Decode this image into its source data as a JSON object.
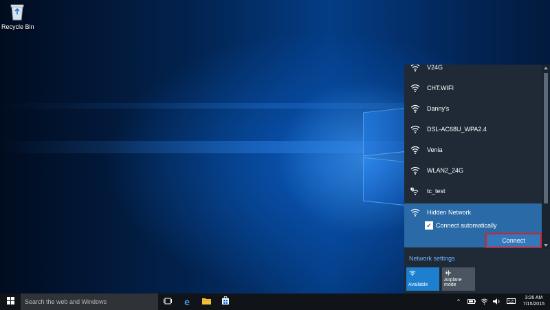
{
  "desktop": {
    "recycle_bin_label": "Recycle Bin"
  },
  "network_flyout": {
    "networks": [
      {
        "name": "V24G",
        "secured": true
      },
      {
        "name": "CHT.WIFI",
        "secured": false
      },
      {
        "name": "Danny's",
        "secured": true
      },
      {
        "name": "DSL-AC68U_WPA2.4",
        "secured": true
      },
      {
        "name": "Venia",
        "secured": true
      },
      {
        "name": "WLAN2_24G",
        "secured": true
      },
      {
        "name": "tc_test",
        "secured": false,
        "warning": true
      }
    ],
    "selected_network": {
      "name": "Hidden Network",
      "connect_automatically_label": "Connect automatically",
      "connect_automatically_checked": true,
      "connect_label": "Connect"
    },
    "network_settings_label": "Network settings",
    "quick_actions": [
      {
        "label": "Available",
        "icon": "wifi-icon",
        "active": true
      },
      {
        "label": "Airplane mode",
        "icon": "airplane-icon",
        "active": false
      }
    ]
  },
  "taskbar": {
    "search_placeholder": "Search the web and Windows",
    "clock_time": "3:26 AM",
    "clock_date": "7/15/2015"
  },
  "colors": {
    "accent": "#2a6aa6",
    "connect_highlight": "#d8202a",
    "link": "#6fb4ff"
  }
}
